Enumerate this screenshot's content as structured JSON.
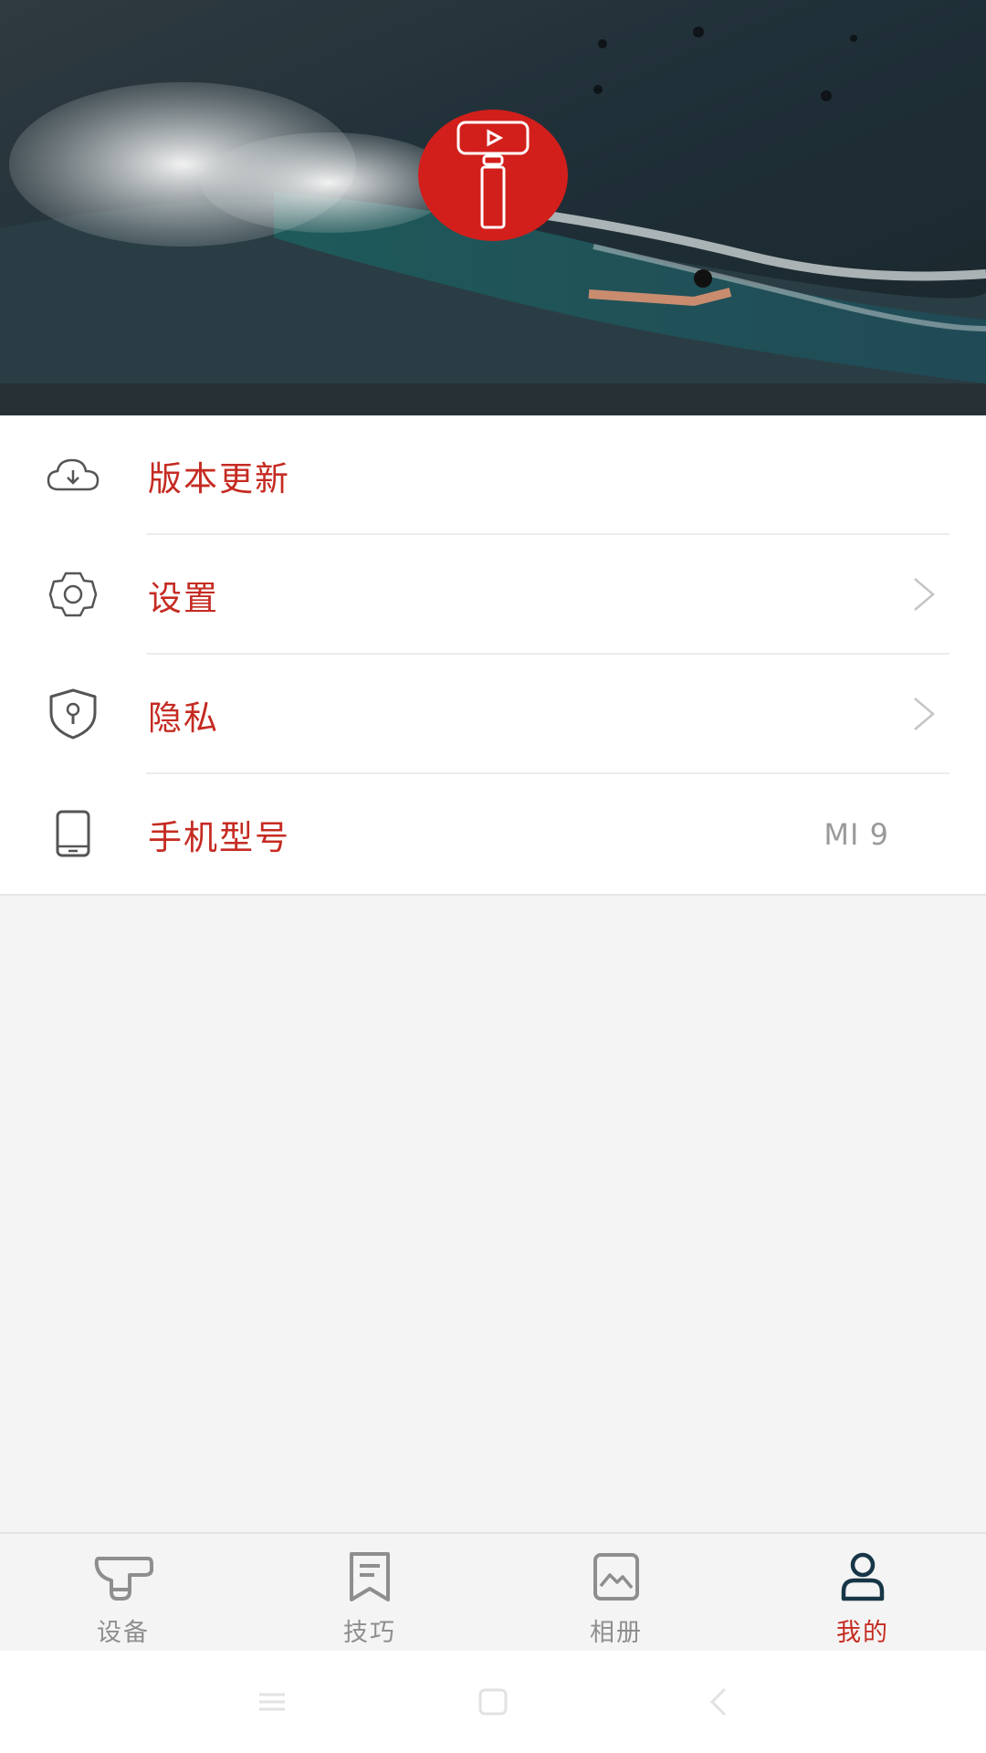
{
  "header": {
    "logo_icon": "gimbal-stabilizer-icon",
    "brand_color": "#d21f1b",
    "background": "surf-wave-photo"
  },
  "menu": {
    "items": [
      {
        "label": "版本更新",
        "icon": "cloud-download-icon"
      },
      {
        "label": "设置",
        "icon": "gear-icon",
        "chevron": true
      },
      {
        "label": "隐私",
        "icon": "shield-keyhole-icon",
        "chevron": true
      },
      {
        "label": "手机型号",
        "icon": "phone-icon",
        "value": "MI 9"
      }
    ]
  },
  "tabs": [
    {
      "label": "设备",
      "icon": "gimbal-icon"
    },
    {
      "label": "技巧",
      "icon": "bookmark-doc-icon"
    },
    {
      "label": "相册",
      "icon": "image-icon"
    },
    {
      "label": "我的",
      "icon": "user-icon",
      "active": true
    }
  ],
  "colors": {
    "accent": "#c52b22",
    "active_icon": "#173647",
    "inactive": "#8e8e8e"
  }
}
